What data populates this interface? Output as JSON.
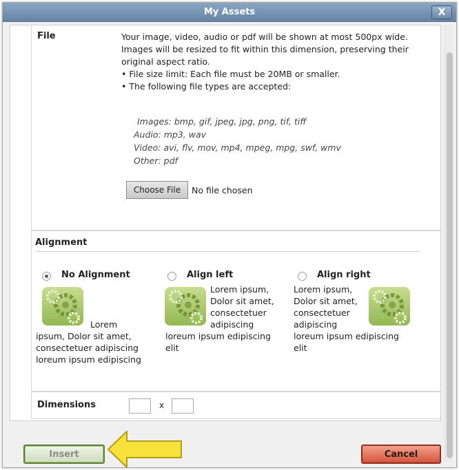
{
  "window": {
    "title": "My Assets",
    "close_label": "X"
  },
  "file": {
    "label": "File",
    "description": "Your image, video, audio or pdf will be shown at most 500px wide. Images will be resized to fit within this dimension, preserving their original aspect ratio.",
    "bullets": [
      "• File size limit: Each file must be 20MB or smaller.",
      "• The following file types are accepted:"
    ],
    "types": [
      "Images: bmp, gif, jpeg, jpg, png, tif, tiff",
      "Audio: mp3, wav",
      "Video: avi, flv, mov, mp4, mpeg, mpg, swf, wmv",
      "Other: pdf"
    ],
    "choose_button": "Choose File",
    "status": "No file chosen"
  },
  "alignment": {
    "header": "Alignment",
    "options": [
      {
        "label": "No Alignment",
        "selected": true
      },
      {
        "label": "Align left",
        "selected": false
      },
      {
        "label": "Align right",
        "selected": false
      }
    ],
    "samples": {
      "none": [
        "Lorem",
        "ipsum, Dolor sit amet,",
        "consectetuer adipiscing",
        "loreum ipsum edipiscing"
      ],
      "left": [
        "Lorem ipsum,",
        "Dolor sit amet,",
        "consectetuer",
        "adipiscing",
        "loreum ipsum edipiscing",
        "elit"
      ],
      "right": [
        "Lorem ipsum,",
        "Dolor sit amet,",
        "consectetuer",
        "adipiscing",
        "loreum ipsum edipiscing",
        "elit"
      ]
    }
  },
  "dimensions": {
    "label": "Dimensions",
    "separator": "x",
    "width_value": "",
    "height_value": ""
  },
  "footer": {
    "insert_label": "Insert",
    "cancel_label": "Cancel"
  },
  "colors": {
    "arrow": "#f7e23b",
    "insert_border": "#5b7d2d",
    "cancel_fill": "#d5543c",
    "titlebar": "#7592b3"
  }
}
